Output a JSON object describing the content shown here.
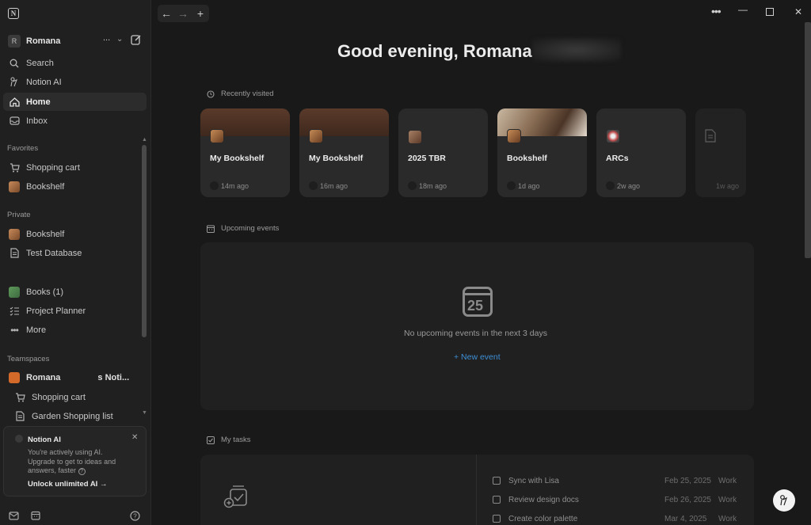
{
  "sidebar": {
    "workspace": {
      "avatar": "R",
      "name": "Romana",
      "more": "..."
    },
    "nav": [
      {
        "label": "Search",
        "icon": "search-icon"
      },
      {
        "label": "Notion AI",
        "icon": "notion-ai-icon"
      },
      {
        "label": "Home",
        "icon": "home-icon",
        "active": true
      },
      {
        "label": "Inbox",
        "icon": "inbox-icon"
      }
    ],
    "favorites_label": "Favorites",
    "favorites": [
      {
        "label": "Shopping cart",
        "icon": "cart-icon"
      },
      {
        "label": "Bookshelf",
        "icon": "bookshelf-icon"
      }
    ],
    "private_label": "Private",
    "private": [
      {
        "label": "Bookshelf",
        "icon": "bookshelf-icon"
      },
      {
        "label": "Test Database",
        "icon": "document-icon"
      },
      {
        "label": "Books (1)",
        "icon": "books-icon"
      },
      {
        "label": "Project Planner",
        "icon": "checklist-icon"
      },
      {
        "label": "More",
        "icon": "more-icon"
      }
    ],
    "teamspaces_label": "Teamspaces",
    "teamspace": {
      "name": "Romana",
      "suffix": "s Noti..."
    },
    "teamspace_items": [
      {
        "label": "Shopping cart",
        "icon": "cart-icon"
      },
      {
        "label": "Garden Shopping list",
        "icon": "document-icon"
      }
    ],
    "ai_card": {
      "title": "Notion AI",
      "body": "You're actively using AI. Upgrade to get to ideas and answers, faster",
      "link": "Unlock unlimited AI"
    }
  },
  "main": {
    "greeting": "Good evening, Romana",
    "recent_label": "Recently visited",
    "recent": [
      {
        "title": "My Bookshelf",
        "time": "14m ago"
      },
      {
        "title": "My Bookshelf",
        "time": "16m ago"
      },
      {
        "title": "2025 TBR",
        "time": "18m ago"
      },
      {
        "title": "Bookshelf",
        "time": "1d ago"
      },
      {
        "title": "ARCs",
        "time": "2w ago"
      },
      {
        "title": "",
        "time": "1w ago"
      }
    ],
    "events_label": "Upcoming events",
    "calendar_day": "25",
    "no_events": "No upcoming events in the next 3 days",
    "new_event": "+ New event",
    "tasks_label": "My tasks",
    "tasks": [
      {
        "name": "Sync with Lisa",
        "date": "Feb 25, 2025",
        "tag": "Work"
      },
      {
        "name": "Review design docs",
        "date": "Feb 26, 2025",
        "tag": "Work"
      },
      {
        "name": "Create color palette",
        "date": "Mar 4, 2025",
        "tag": "Work"
      }
    ]
  }
}
